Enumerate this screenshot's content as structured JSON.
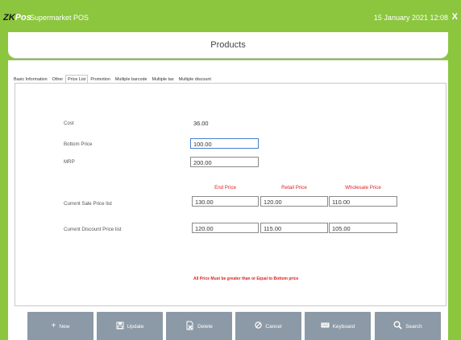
{
  "topbar": {
    "brand_prefix": "ZK",
    "brand_suffix": "Pos",
    "app_title": "Supermarket POS",
    "datetime": "15 January 2021 12:08",
    "close_label": "X"
  },
  "header": {
    "title": "Products"
  },
  "tabs": [
    {
      "label": "Basic Information",
      "active": false
    },
    {
      "label": "Other",
      "active": false
    },
    {
      "label": "Price List",
      "active": true
    },
    {
      "label": "Promotion",
      "active": false
    },
    {
      "label": "Multiple barcode",
      "active": false
    },
    {
      "label": "Multiple tax",
      "active": false
    },
    {
      "label": "Multiple discount",
      "active": false
    }
  ],
  "form": {
    "cost_label": "Cost",
    "cost_value": "36.00",
    "bottom_price_label": "Bottom Price",
    "bottom_price_value": "100.00",
    "mrp_label": "MRP",
    "mrp_value": "200.00",
    "columns": {
      "end_price": "End Price",
      "retail_price": "Retail Price",
      "wholesale_price": "Wholesale Price"
    },
    "sale_label": "Current Sale Price list",
    "sale_end": "130.00",
    "sale_retail": "120.00",
    "sale_wholesale": "110.00",
    "discount_label": "Current Discount Price list",
    "discount_end": "120.00",
    "discount_retail": "115.00",
    "discount_wholesale": "105.00",
    "warning": "All Price Must be greater than  or Equal to Bottom price"
  },
  "toolbar": {
    "new_label": "New",
    "update_label": "Update",
    "delete_label": "Delete",
    "cancel_label": "Cancel",
    "keyboard_label": "Keyboard",
    "search_label": "Search"
  },
  "colors": {
    "accent_green": "#8cc63f",
    "button_gray": "#8c99a6",
    "warning_red": "#e02020"
  }
}
